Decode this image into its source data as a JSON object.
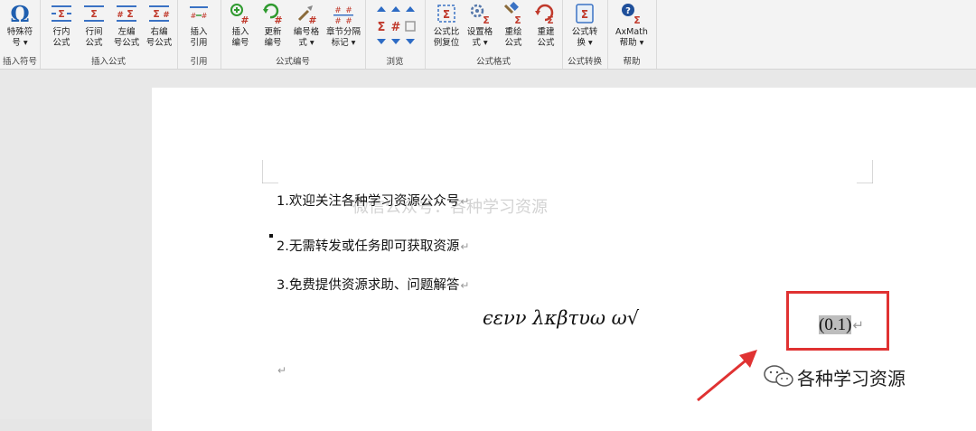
{
  "ribbon": {
    "groups": [
      {
        "label": "插入符号",
        "buttons": [
          {
            "label": "特殊符\n号 ▾",
            "icon": "omega-icon"
          }
        ]
      },
      {
        "label": "插入公式",
        "buttons": [
          {
            "label": "行内\n公式",
            "icon": "inline-equation-icon"
          },
          {
            "label": "行间\n公式",
            "icon": "display-equation-icon"
          },
          {
            "label": "左编\n号公式",
            "icon": "left-numbered-equation-icon"
          },
          {
            "label": "右编\n号公式",
            "icon": "right-numbered-equation-icon"
          }
        ]
      },
      {
        "label": "引用",
        "buttons": [
          {
            "label": "插入\n引用",
            "icon": "insert-reference-icon"
          }
        ]
      },
      {
        "label": "公式编号",
        "buttons": [
          {
            "label": "插入\n编号",
            "icon": "insert-number-icon"
          },
          {
            "label": "更新\n编号",
            "icon": "update-number-icon"
          },
          {
            "label": "编号格\n式 ▾",
            "icon": "number-format-icon"
          },
          {
            "label": "章节分隔\n标记 ▾",
            "icon": "chapter-separator-icon"
          }
        ]
      },
      {
        "label": "浏览",
        "buttons": []
      },
      {
        "label": "公式格式",
        "buttons": [
          {
            "label": "公式比\n例复位",
            "icon": "reset-scale-icon"
          },
          {
            "label": "设置格\n式 ▾",
            "icon": "set-format-icon"
          },
          {
            "label": "重绘\n公式",
            "icon": "redraw-equation-icon"
          },
          {
            "label": "重建\n公式",
            "icon": "rebuild-equation-icon"
          }
        ]
      },
      {
        "label": "公式转换",
        "buttons": [
          {
            "label": "公式转\n换 ▾",
            "icon": "convert-equation-icon"
          }
        ]
      },
      {
        "label": "帮助",
        "buttons": [
          {
            "label": "AxMath\n帮助 ▾",
            "icon": "help-icon"
          }
        ]
      }
    ]
  },
  "document": {
    "paragraphs": [
      "1.欢迎关注各种学习资源公众号",
      "2.无需转发或任务即可获取资源",
      "3.免费提供资源求助、问题解答"
    ],
    "paragraph_mark": "↵",
    "watermark": "微信公众号：各种学习资源",
    "equation": "ϵενν λκβτυω ω√",
    "equation_number": "(0.1)",
    "empty_paragraph_mark": "↵"
  },
  "wechat_badge": "各种学习资源",
  "colors": {
    "annotation": "#e03232",
    "ribbon_bg": "#f3f3f3",
    "page_bg": "#ffffff"
  }
}
